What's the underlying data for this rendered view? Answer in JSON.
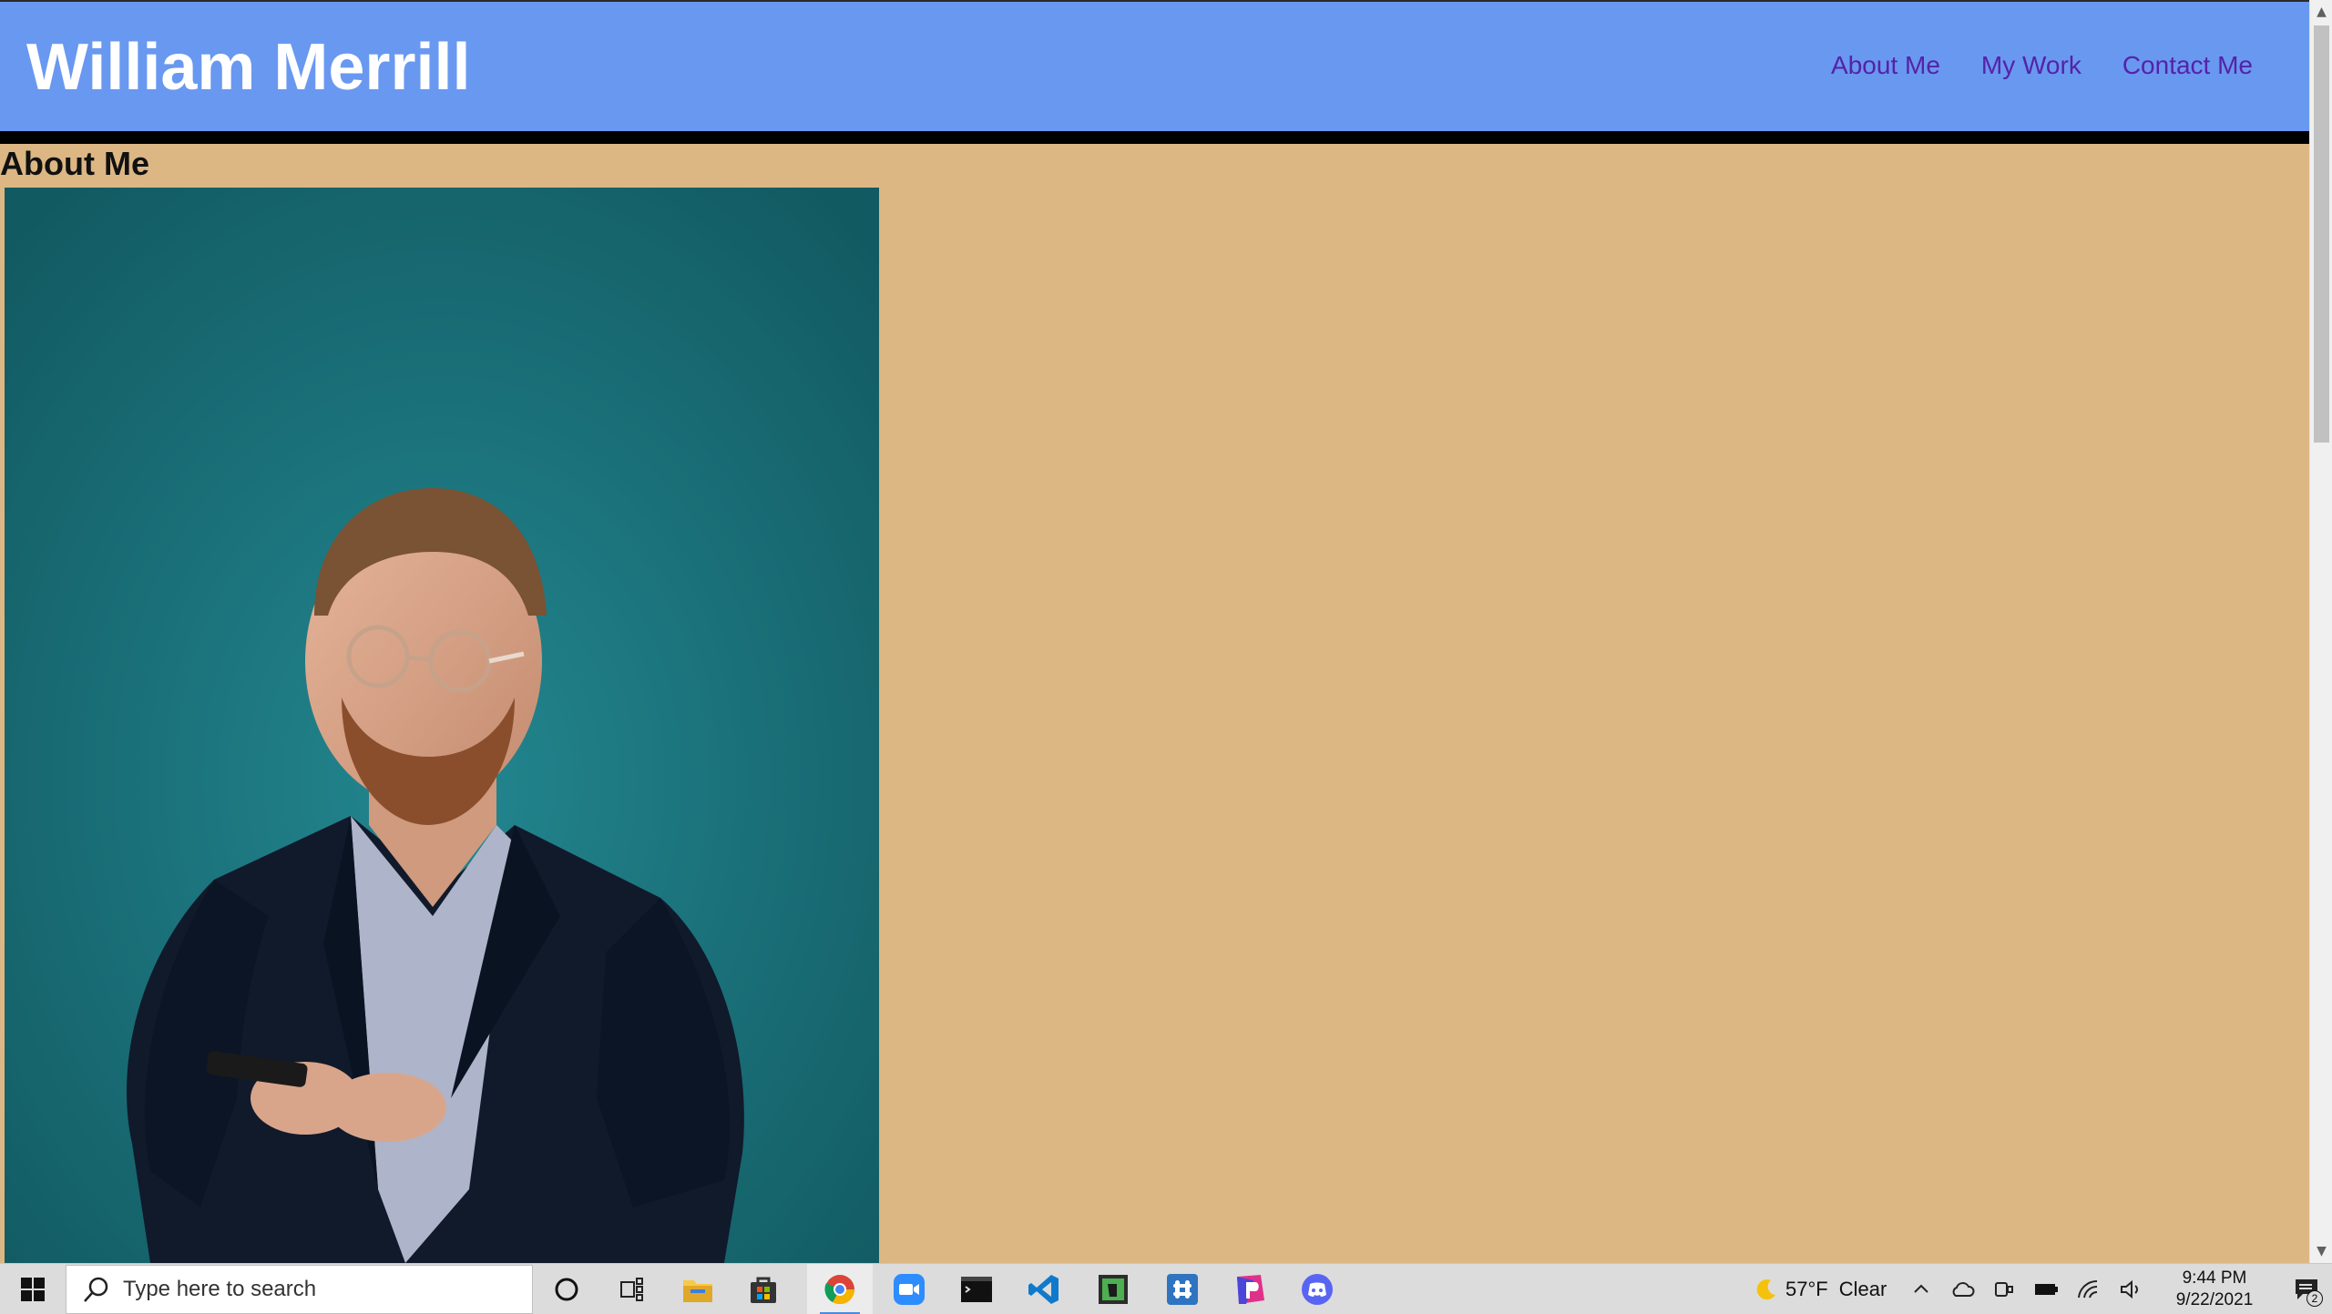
{
  "site": {
    "title": "William Merrill",
    "nav": [
      {
        "label": "About Me"
      },
      {
        "label": "My Work"
      },
      {
        "label": "Contact Me"
      }
    ]
  },
  "about": {
    "heading": "About Me"
  },
  "colors": {
    "header_bg": "#6998f0",
    "page_bg": "#dcb784",
    "nav_link": "#5522a8",
    "photo_bg": "#1f7c84"
  },
  "taskbar": {
    "search_placeholder": "Type here to search",
    "pinned": [
      "cortana-icon",
      "task-view-icon",
      "file-explorer-icon",
      "store-icon",
      "chrome-icon",
      "zoom-icon",
      "terminal-icon",
      "vscode-icon",
      "evernote-icon",
      "slack-icon",
      "pycharm-icon",
      "discord-icon"
    ],
    "weather": {
      "temp": "57°F",
      "condition": "Clear"
    },
    "clock": {
      "time": "9:44 PM",
      "date": "9/22/2021"
    },
    "notifications": "2"
  }
}
